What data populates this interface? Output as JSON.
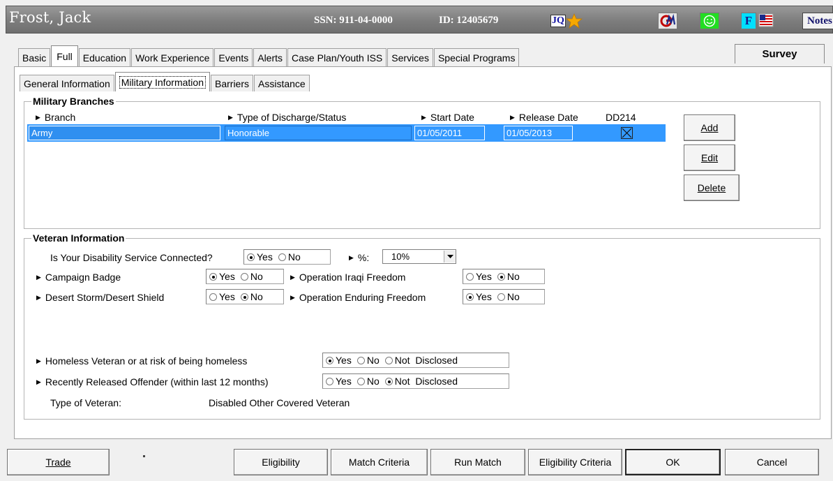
{
  "header": {
    "name": "Frost, Jack",
    "ssn": "SSN: 911-04-0000",
    "id": "ID: 12405679",
    "jq_label": "JQ",
    "f_label": "F",
    "notes_label": "Notes"
  },
  "main_tabs": [
    "Basic",
    "Full",
    "Education",
    "Work Experience",
    "Events",
    "Alerts",
    "Case Plan/Youth ISS",
    "Services",
    "Special Programs"
  ],
  "survey_label": "Survey",
  "sub_tabs": [
    "General Information",
    "Military Information",
    "Barriers",
    "Assistance"
  ],
  "military": {
    "title": "Military Branches",
    "headers": {
      "branch": "Branch",
      "discharge": "Type of Discharge/Status",
      "start": "Start Date",
      "release": "Release Date",
      "dd214": "DD214"
    },
    "rows": [
      {
        "branch": "Army",
        "discharge": "Honorable",
        "start": "01/05/2011",
        "release": "01/05/2013",
        "dd214": true
      }
    ],
    "buttons": {
      "add": "Add",
      "edit": "Edit",
      "delete": "Delete"
    }
  },
  "veteran": {
    "title": "Veteran Information",
    "disability_label": "Is Your Disability Service Connected?",
    "disability_value": "Yes",
    "pct_label": "%:",
    "pct_value": "10%",
    "campaign_label": "Campaign Badge",
    "campaign_value": "Yes",
    "iraqi_label": "Operation Iraqi Freedom",
    "iraqi_value": "No",
    "desert_label": "Desert Storm/Desert Shield",
    "desert_value": "No",
    "enduring_label": "Operation Enduring Freedom",
    "enduring_value": "Yes",
    "homeless_label": "Homeless Veteran or at risk of being homeless",
    "homeless_value": "Yes",
    "offender_label": "Recently Released Offender (within last 12 months)",
    "offender_value": "Not Disclosed",
    "type_label": "Type of Veteran:",
    "type_value": "Disabled Other Covered Veteran",
    "yes": "Yes",
    "no": "No",
    "not_disclosed": "Not  Disclosed"
  },
  "footer": {
    "trade": "Trade",
    "eligibility": "Eligibility",
    "match_criteria": "Match Criteria",
    "run_match": "Run Match",
    "eligibility_criteria": "Eligibility Criteria",
    "ok": "OK",
    "cancel": "Cancel"
  },
  "colors": {
    "titlebar": "#7d7d7d",
    "selection": "#3399ff",
    "smiley_bg": "#22dd22",
    "f_bg": "#00e0ff"
  }
}
